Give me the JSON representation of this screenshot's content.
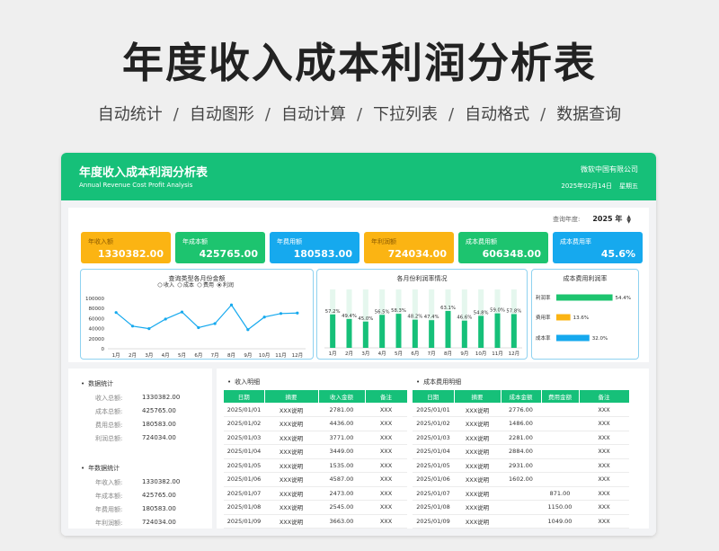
{
  "headline": "年度收入成本利润分析表",
  "features": [
    "自动统计",
    "自动图形",
    "自动计算",
    "下拉列表",
    "自动格式",
    "数据查询"
  ],
  "panel": {
    "title": "年度收入成本利润分析表",
    "subtitle": "Annual Revenue Cost Profit Analysis",
    "company": "微软中国有限公司",
    "date": "2025年02月14日",
    "weekday": "星期五"
  },
  "year_select": {
    "label": "查询年度:",
    "value": "2025 年"
  },
  "kpis": [
    {
      "label": "年收入额",
      "value": "1330382.00",
      "color": "orange"
    },
    {
      "label": "年成本额",
      "value": "425765.00",
      "color": "green"
    },
    {
      "label": "年费用额",
      "value": "180583.00",
      "color": "blue"
    },
    {
      "label": "年利润额",
      "value": "724034.00",
      "color": "orange"
    },
    {
      "label": "成本费用额",
      "value": "606348.00",
      "color": "green"
    },
    {
      "label": "成本费用率",
      "value": "45.6%",
      "color": "blue"
    }
  ],
  "chart_data": [
    {
      "type": "line",
      "title": "查询类型各月份金额",
      "legend_options": [
        "收入",
        "成本",
        "费用",
        "利润"
      ],
      "selected": "利润",
      "categories": [
        "1月",
        "2月",
        "3月",
        "4月",
        "5月",
        "6月",
        "7月",
        "8月",
        "9月",
        "10月",
        "11月",
        "12月"
      ],
      "series": [
        {
          "name": "利润",
          "values": [
            72000,
            45000,
            40000,
            59000,
            73000,
            42000,
            50000,
            87000,
            38000,
            63000,
            70000,
            71000
          ]
        }
      ],
      "yticks": [
        "100000",
        "80000",
        "60000",
        "40000",
        "20000",
        "0"
      ],
      "ylim": [
        0,
        100000
      ],
      "color": "#16a9ee"
    },
    {
      "type": "bar",
      "title": "各月份利润率情况",
      "categories": [
        "1月",
        "2月",
        "3月",
        "4月",
        "5月",
        "6月",
        "7月",
        "8月",
        "9月",
        "10月",
        "11月",
        "12月"
      ],
      "labels": [
        "57.2%",
        "49.4%",
        "45.0%",
        "56.5%",
        "58.3%",
        "48.2%",
        "47.4%",
        "63.1%",
        "46.6%",
        "54.8%",
        "59.0%",
        "57.8%"
      ],
      "values": [
        57.2,
        49.4,
        45.0,
        56.5,
        58.3,
        48.2,
        47.4,
        63.1,
        46.6,
        54.8,
        59.0,
        57.8
      ],
      "ylim": [
        0,
        100
      ],
      "color": "#16c079",
      "bg_color": "#e5f7ee"
    },
    {
      "type": "bar",
      "title": "成本费用利润率",
      "categories": [
        "利润率",
        "费用率",
        "成本率"
      ],
      "labels": [
        "54.4%",
        "13.6%",
        "32.0%"
      ],
      "values": [
        54.4,
        13.6,
        32.0
      ],
      "colors": [
        "#1dc46f",
        "#fbb413",
        "#16a9ee"
      ],
      "xlim": [
        0,
        60
      ]
    }
  ],
  "stats": {
    "section1_title": "数据统计",
    "section1": [
      {
        "label": "收入总额:",
        "value": "1330382.00"
      },
      {
        "label": "成本总额:",
        "value": "425765.00"
      },
      {
        "label": "费用总额:",
        "value": "180583.00"
      },
      {
        "label": "利润总额:",
        "value": "724034.00"
      }
    ],
    "section2_title": "年数据统计",
    "section2": [
      {
        "label": "年收入额:",
        "value": "1330382.00"
      },
      {
        "label": "年成本额:",
        "value": "425765.00"
      },
      {
        "label": "年费用额:",
        "value": "180583.00"
      },
      {
        "label": "年利润额:",
        "value": "724034.00"
      }
    ]
  },
  "income_table": {
    "title": "收入明细",
    "headers": [
      "日期",
      "摘要",
      "收入金额",
      "备注"
    ],
    "rows": [
      [
        "2025/01/01",
        "XXX说明",
        "2781.00",
        "XXX"
      ],
      [
        "2025/01/02",
        "XXX说明",
        "4436.00",
        "XXX"
      ],
      [
        "2025/01/03",
        "XXX说明",
        "3771.00",
        "XXX"
      ],
      [
        "2025/01/04",
        "XXX说明",
        "3449.00",
        "XXX"
      ],
      [
        "2025/01/05",
        "XXX说明",
        "1535.00",
        "XXX"
      ],
      [
        "2025/01/06",
        "XXX说明",
        "4587.00",
        "XXX"
      ],
      [
        "2025/01/07",
        "XXX说明",
        "2473.00",
        "XXX"
      ],
      [
        "2025/01/08",
        "XXX说明",
        "2545.00",
        "XXX"
      ],
      [
        "2025/01/09",
        "XXX说明",
        "3663.00",
        "XXX"
      ]
    ]
  },
  "cost_table": {
    "title": "成本费用明细",
    "headers": [
      "日期",
      "摘要",
      "成本金额",
      "费用金额",
      "备注"
    ],
    "rows": [
      [
        "2025/01/01",
        "XXX说明",
        "2776.00",
        "",
        "XXX"
      ],
      [
        "2025/01/02",
        "XXX说明",
        "1486.00",
        "",
        "XXX"
      ],
      [
        "2025/01/03",
        "XXX说明",
        "2281.00",
        "",
        "XXX"
      ],
      [
        "2025/01/04",
        "XXX说明",
        "2884.00",
        "",
        "XXX"
      ],
      [
        "2025/01/05",
        "XXX说明",
        "2931.00",
        "",
        "XXX"
      ],
      [
        "2025/01/06",
        "XXX说明",
        "1602.00",
        "",
        "XXX"
      ],
      [
        "2025/01/07",
        "XXX说明",
        "",
        "871.00",
        "XXX"
      ],
      [
        "2025/01/08",
        "XXX说明",
        "",
        "1150.00",
        "XXX"
      ],
      [
        "2025/01/09",
        "XXX说明",
        "",
        "1049.00",
        "XXX"
      ]
    ]
  }
}
